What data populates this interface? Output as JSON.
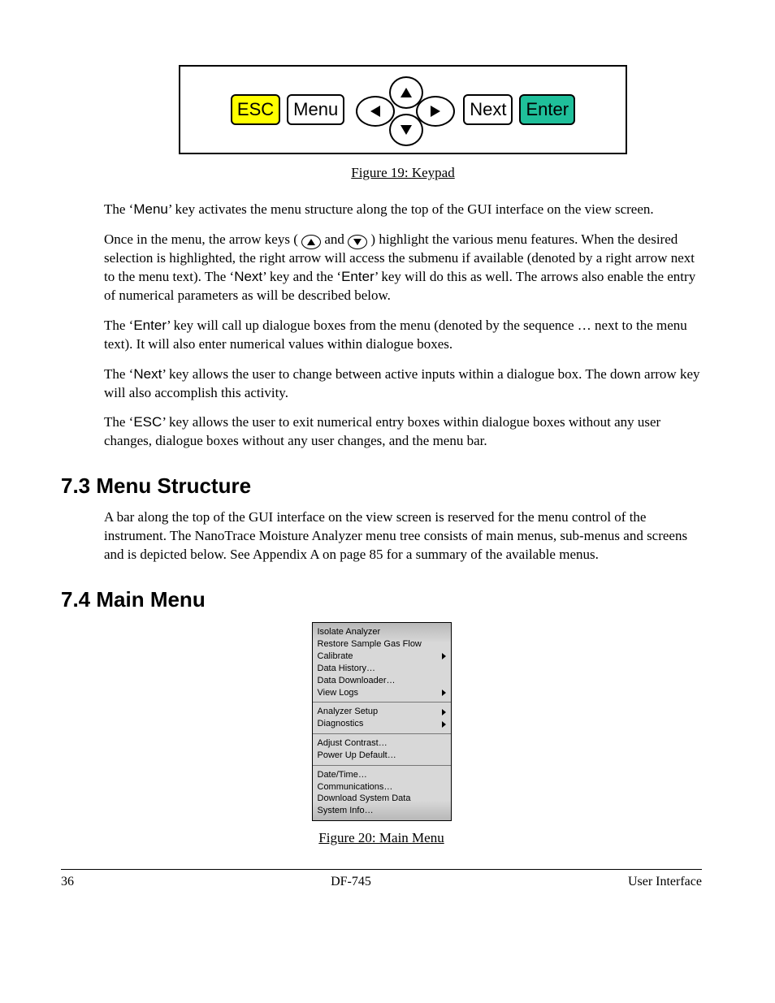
{
  "keypad": {
    "esc": "ESC",
    "menu": "Menu",
    "next": "Next",
    "enter": "Enter"
  },
  "figures": {
    "keypad_caption": "Figure 19: Keypad",
    "mainmenu_caption": "Figure 20: Main Menu"
  },
  "paragraphs": {
    "p1_a": "The ‘",
    "p1_key": "Menu",
    "p1_b": "’ key activates the menu structure along the top of the GUI interface on the view screen.",
    "p2_a": "Once in the menu, the arrow keys ( ",
    "p2_b": " and ",
    "p2_c": " ) highlight the various menu features.  When the desired selection is highlighted, the right arrow will access the submenu if available (denoted by a right arrow next to the menu text).  The ‘",
    "p2_key1": "Next",
    "p2_d": "’ key and the ‘",
    "p2_key2": "Enter",
    "p2_e": "’ key will do this as well.  The arrows also enable the entry of numerical parameters as will be described below.",
    "p3_a": "The ‘",
    "p3_key": "Enter",
    "p3_b": "’ key will call up dialogue boxes from the menu (denoted by the sequence … next to the menu text).  It will also enter numerical values within dialogue boxes.",
    "p4_a": "The ‘",
    "p4_key": "Next",
    "p4_b": "’ key allows the user to change between active inputs within a dialogue box.  The down arrow key will also accomplish this activity.",
    "p5_a": "The ‘",
    "p5_key": "ESC",
    "p5_b": "’ key allows the user to exit numerical entry boxes within dialogue boxes without any user changes, dialogue boxes without any user changes, and the menu bar."
  },
  "sections": {
    "s73": "7.3 Menu Structure",
    "s73_body": "A bar along the top of the GUI interface on the view screen is reserved for the menu control of the instrument. The NanoTrace Moisture Analyzer menu tree consists of main menus, sub-menus and screens and is depicted below. See Appendix A on page 85 for a summary of the available menus.",
    "s74": "7.4 Main Menu"
  },
  "main_menu": {
    "g1": {
      "i1": "Isolate Analyzer",
      "i2": "Restore Sample Gas Flow",
      "i3": "Calibrate",
      "i4": "Data History…",
      "i5": "Data Downloader…",
      "i6": "View Logs"
    },
    "g2": {
      "i1": "Analyzer Setup",
      "i2": "Diagnostics"
    },
    "g3": {
      "i1": "Adjust Contrast…",
      "i2": "Power Up Default…"
    },
    "g4": {
      "i1": "Date/Time…",
      "i2": "Communications…",
      "i3": "Download System Data",
      "i4": "System Info…"
    }
  },
  "footer": {
    "page": "36",
    "center": "DF-745",
    "right": "User Interface"
  }
}
